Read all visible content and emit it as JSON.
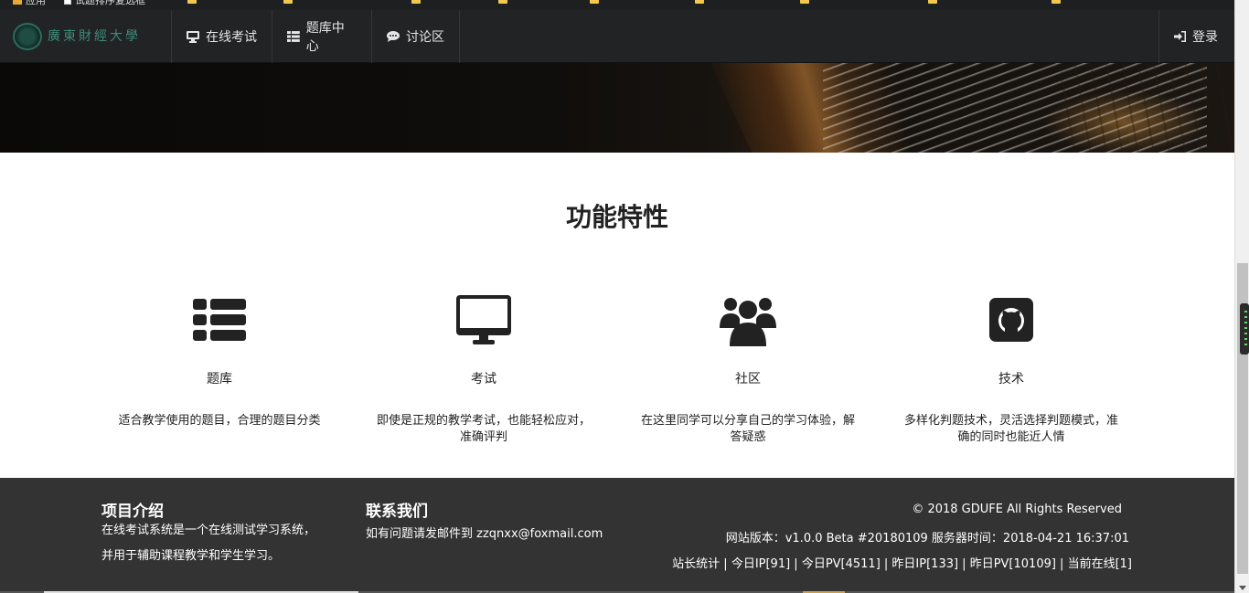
{
  "bookmarks": {
    "items": [
      "应用",
      "试题排序复选框"
    ]
  },
  "navbar": {
    "brand_text": "廣東財經大學",
    "items": [
      {
        "label": "在线考试",
        "icon": "desktop-icon"
      },
      {
        "label": "题库中心",
        "icon": "list-icon"
      },
      {
        "label": "讨论区",
        "icon": "chat-icon"
      }
    ],
    "login_label": "登录",
    "login_icon": "sign-in-icon"
  },
  "features": {
    "title": "功能特性",
    "items": [
      {
        "name": "题库",
        "icon": "list-icon",
        "desc": "适合教学使用的题目，合理的题目分类"
      },
      {
        "name": "考试",
        "icon": "desktop-icon",
        "desc": "即使是正规的教学考试，也能轻松应对，准确评判"
      },
      {
        "name": "社区",
        "icon": "users-icon",
        "desc": "在这里同学可以分享自己的学习体验，解答疑惑"
      },
      {
        "name": "技术",
        "icon": "github-icon",
        "desc": "多样化判题技术，灵活选择判题模式，准确的同时也能近人情"
      }
    ]
  },
  "footer": {
    "about_title": "项目介绍",
    "about_line1": "在线考试系统是一个在线测试学习系统，",
    "about_line2": "并用于辅助课程教学和学生学习。",
    "contact_title": "联系我们",
    "contact_text": "如有问题请发邮件到 zzqnxx@foxmail.com",
    "copyright": "© 2018 GDUFE All Rights Reserved",
    "version": "网站版本：v1.0.0 Beta #20180109  服务器时间：2018-04-21 16:37:01",
    "stats": "站长统计 | 今日IP[91] | 今日PV[4511] | 昨日IP[133] | 昨日PV[10109] | 当前在线[1]"
  },
  "colors": {
    "navbar_bg": "#222325",
    "footer_bg": "#333333",
    "brand_green": "#3c8c78"
  }
}
